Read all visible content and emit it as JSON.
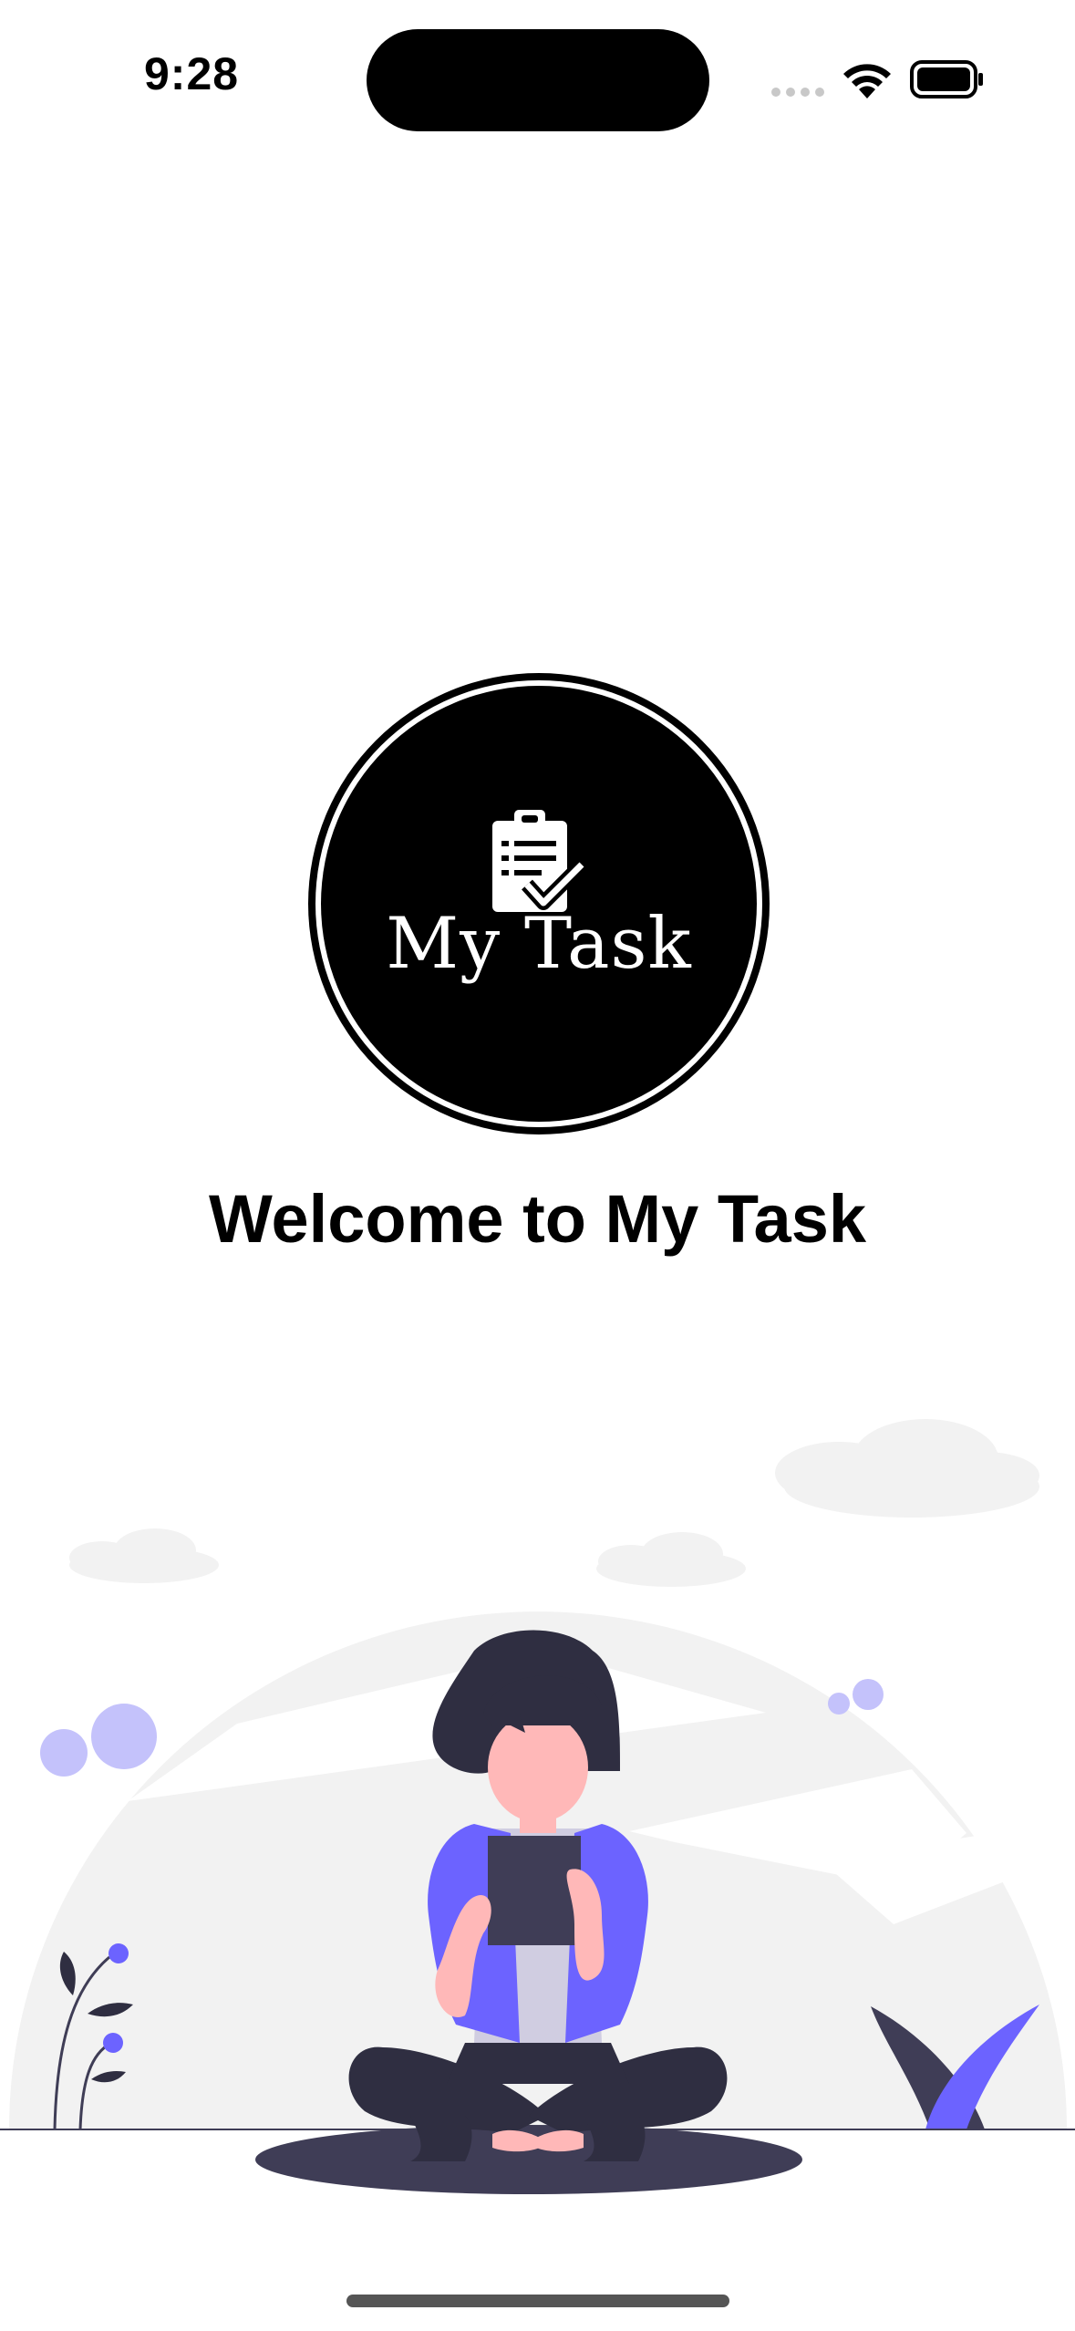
{
  "status_bar": {
    "time": "9:28"
  },
  "logo": {
    "text": "My Task",
    "icon": "clipboard-check-icon"
  },
  "welcome": {
    "title": "Welcome to My Task"
  },
  "colors": {
    "accent": "#6c63ff",
    "accent_light": "#c4c2fb",
    "dark": "#2f2e41",
    "skin": "#ffb8b8",
    "background_shape": "#f2f2f2"
  }
}
